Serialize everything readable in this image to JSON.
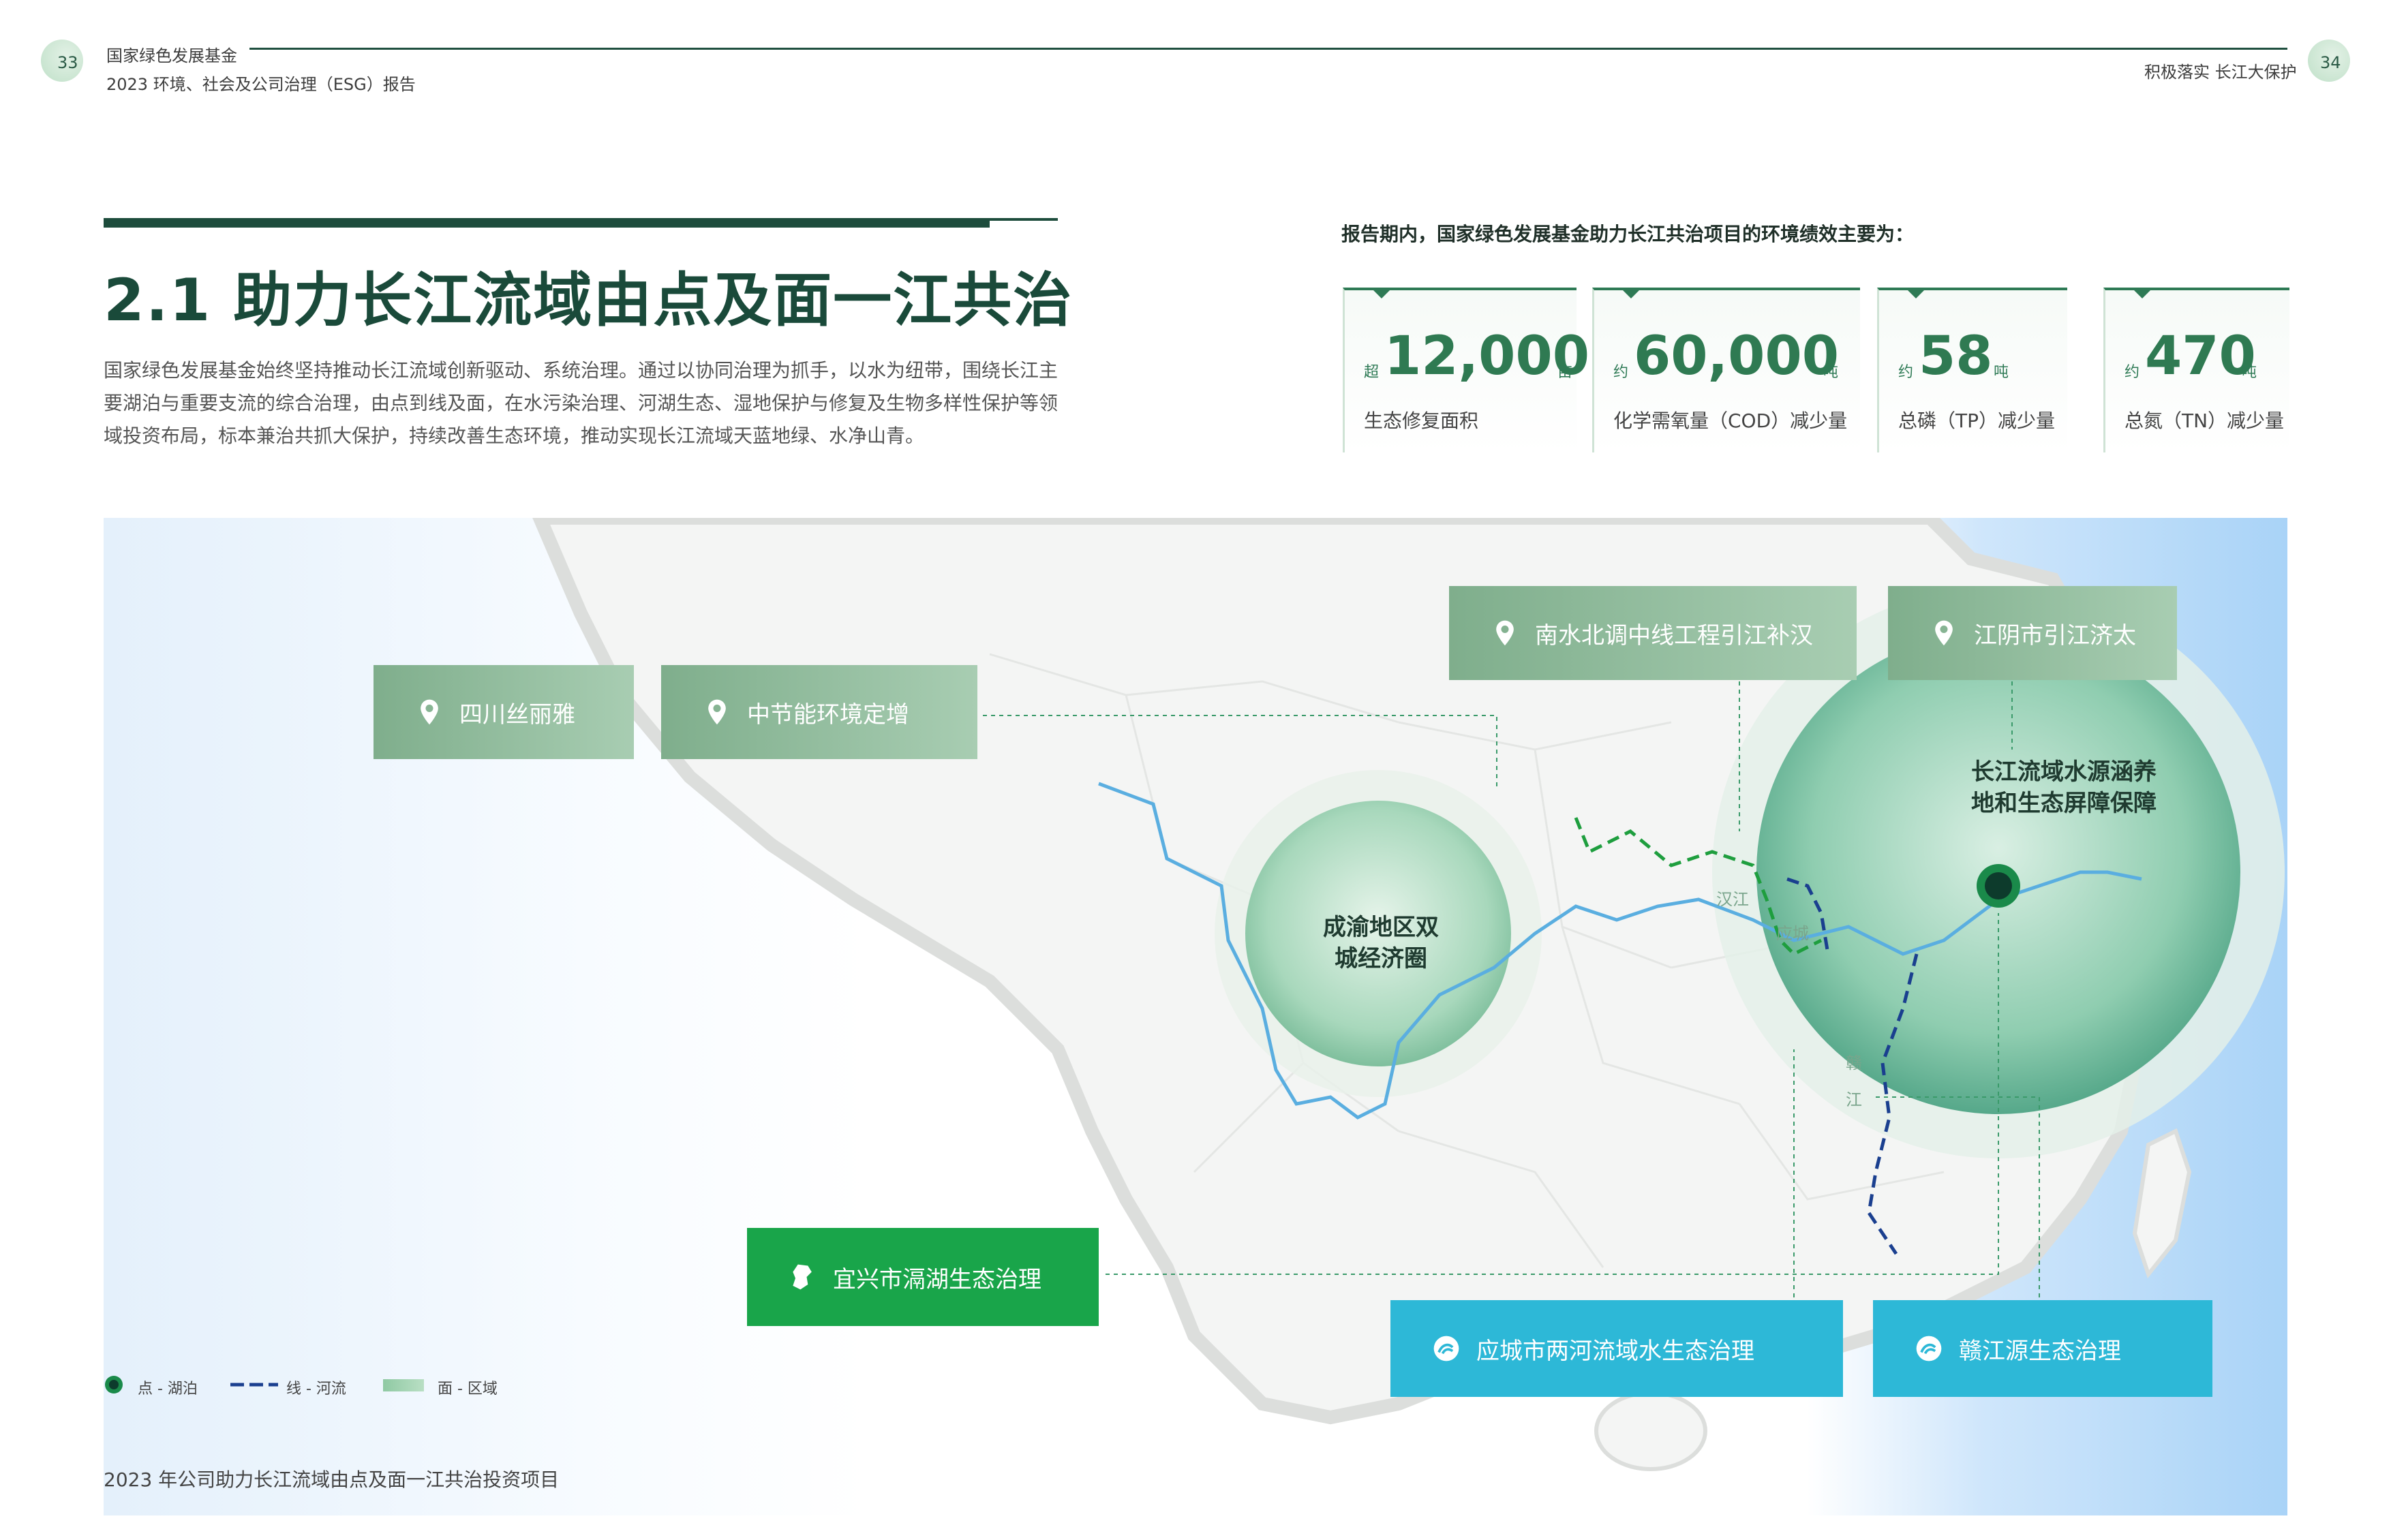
{
  "header": {
    "page_left": "33",
    "page_right": "34",
    "org_name": "国家绿色发展基金",
    "report_name": "2023  环境、社会及公司治理（ESG）报告",
    "section_name": "积极落实 长江大保护"
  },
  "title": "2.1 助力长江流域由点及面一江共治",
  "intro": "国家绿色发展基金始终坚持推动长江流域创新驱动、系统治理。通过以协同治理为抓手，以水为纽带，围绕长江主要湖泊与重要支流的综合治理，由点到线及面，在水污染治理、河湖生态、湿地保护与修复及生物多样性保护等领域投资布局，标本兼治共抓大保护，持续改善生态环境，推动实现长江流域天蓝地绿、水净山青。",
  "stats_intro": "报告期内，国家绿色发展基金助力长江共治项目的环境绩效主要为：",
  "stats": [
    {
      "prefix": "超",
      "value": "12,000",
      "unit": "亩",
      "label": "生态修复面积"
    },
    {
      "prefix": "约",
      "value": "60,000",
      "unit": "吨",
      "label": "化学需氧量（COD）减少量"
    },
    {
      "prefix": "约",
      "value": "58",
      "unit": "吨",
      "label": "总磷（TP）减少量"
    },
    {
      "prefix": "约",
      "value": "470",
      "unit": "吨",
      "label": "总氮（TN）减少量"
    }
  ],
  "map": {
    "projects": {
      "sichuan": "四川丝丽雅",
      "zhongjieneng": "中节能环境定增",
      "nanshui": "南水北调中线工程引江补汉",
      "jiangyin": "江阴市引江济太",
      "yixing": "宜兴市滆湖生态治理",
      "yingcheng": "应城市两河流域水生态治理",
      "ganjiang": "赣江源生态治理"
    },
    "regions": {
      "chengyu": "成渝地区双城经济圈",
      "changjiang": "长江流域水源涵养地和生态屏障保障"
    },
    "rivers": {
      "hanjiang": "汉江",
      "yinghe": "应城",
      "gan1": "赣",
      "gan2": "江"
    },
    "legend": {
      "point": "点 - 湖泊",
      "line": "线 - 河流",
      "area": "面 - 区域"
    },
    "colors": {
      "yangtze": "#5aaee0",
      "han_river": "#1e9e3e",
      "gan_river": "#1a3f8f",
      "lake_dot": "#1a8a4a"
    }
  },
  "caption": "2023 年公司助力长江流域由点及面一江共治投资项目"
}
